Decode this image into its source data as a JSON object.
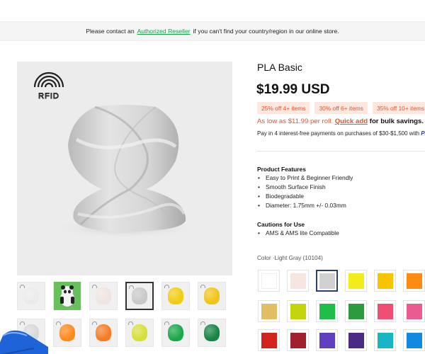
{
  "notice": {
    "before": "Please contact an",
    "link": "Authorized Reseller",
    "after": "if you can't find your country/region in our online store."
  },
  "gallery": {
    "badge_text": "RFID",
    "thumbnails": [
      {
        "color": "#ebebeb",
        "kind": "spool"
      },
      {
        "color": "#67c05b",
        "kind": "panda"
      },
      {
        "color": "#efe5e0",
        "kind": "spool"
      },
      {
        "color": "#c9c9c9",
        "kind": "spool",
        "selected": true
      },
      {
        "color": "#f2cc12",
        "kind": "spool"
      },
      {
        "color": "#f2c419",
        "kind": "spool"
      },
      {
        "color": "#d8d8d8",
        "kind": "spool"
      },
      {
        "color": "#ff8a1c",
        "kind": "spool"
      },
      {
        "color": "#f57c26",
        "kind": "spool"
      },
      {
        "color": "#d6e03a",
        "kind": "spool"
      },
      {
        "color": "#1aa84b",
        "kind": "spool"
      },
      {
        "color": "#178444",
        "kind": "spool"
      }
    ]
  },
  "product": {
    "title": "PLA Basic",
    "price": "$19.99 USD",
    "discounts": [
      "25% off 4+ items",
      "30% off 6+ items",
      "35% off 10+ items"
    ],
    "as_low": "As low as $11.99 per roll.",
    "quick_add": "Quick add",
    "bulk": "for bulk savings.",
    "pay_in": "Pay in 4 interest-free payments on purchases of $30-$1,500 with",
    "pay_brand": "Pa"
  },
  "features": {
    "title": "Product Features",
    "items": [
      "Easy to Print & Beginner Friendly",
      "Smooth Surface Finish",
      "Biodegradable",
      "Diameter: 1.75mm +/- 0.03mm"
    ]
  },
  "cautions": {
    "title": "Cautions for Use",
    "items": [
      "AMS & AMS lite Compatible"
    ]
  },
  "color": {
    "label": "Color",
    "value": "Light Gray (10104)",
    "swatches": [
      "#ffffff",
      "#f7e6df",
      "#d1d1d1",
      "#f2ec1a",
      "#f8c400",
      "#ff8a12",
      "#e2bd63",
      "#c2d60b",
      "#1fbd4a",
      "#2d9a3f",
      "#f04e74",
      "#ec5a92",
      "#d1241d",
      "#a2202d",
      "#5f3fbd",
      "#4b2b85",
      "#19b5c6",
      "#1189e0"
    ],
    "selected_index": 2
  }
}
